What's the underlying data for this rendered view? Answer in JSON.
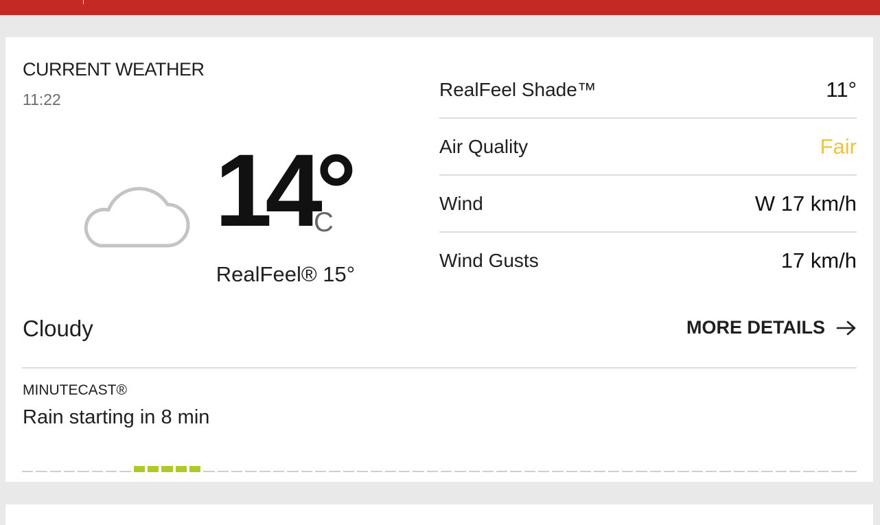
{
  "current": {
    "title": "CURRENT WEATHER",
    "time": "11:22",
    "temperature": "14°",
    "unit": "C",
    "realfeel": "RealFeel® 15°",
    "phrase": "Cloudy",
    "more_details": "MORE DETAILS",
    "icon": "cloud-icon"
  },
  "details": [
    {
      "label": "RealFeel Shade™",
      "value": "11°"
    },
    {
      "label": "Air Quality",
      "value": "Fair",
      "color": "#f0c33a"
    },
    {
      "label": "Wind",
      "value": "W 17 km/h"
    },
    {
      "label": "Wind Gusts",
      "value": "17 km/h"
    }
  ],
  "minutecast": {
    "title": "MINUTECAST®",
    "text": "Rain starting in 8 min",
    "segments": 60,
    "rain_segments": [
      8,
      9,
      10,
      11,
      12
    ],
    "rain_color": "#b2c82a"
  },
  "colors": {
    "brand": "#c32a23",
    "air_quality_fair": "#f0c33a"
  }
}
